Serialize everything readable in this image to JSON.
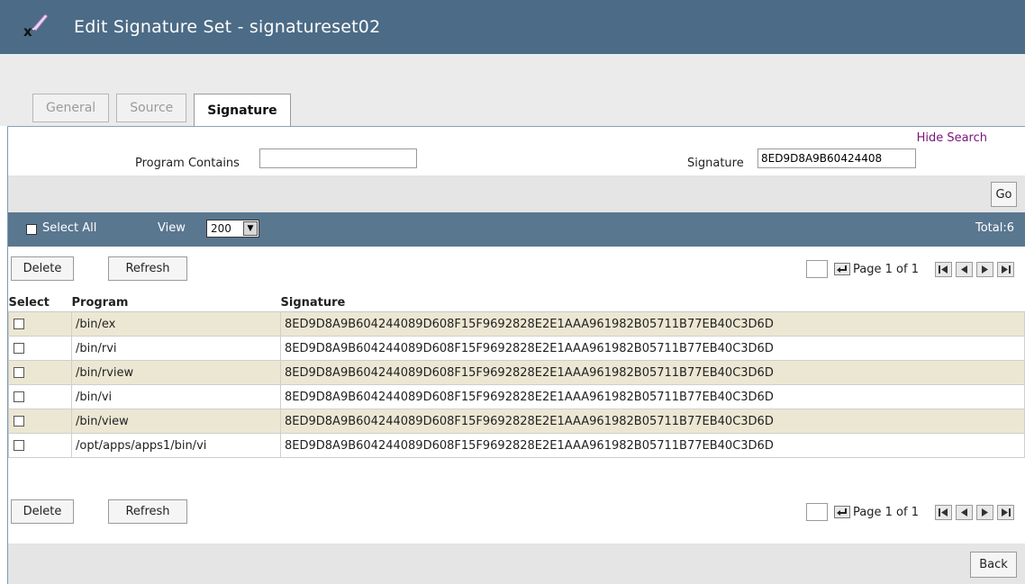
{
  "window": {
    "title": "Edit Signature Set - signatureset02"
  },
  "tabs": [
    {
      "label": "General",
      "active": false
    },
    {
      "label": "Source",
      "active": false
    },
    {
      "label": "Signature",
      "active": true
    }
  ],
  "search": {
    "hide_label": "Hide Search",
    "program_label": "Program Contains",
    "program_value": "",
    "signature_label": "Signature",
    "signature_value": "8ED9D8A9B60424408",
    "go_label": "Go"
  },
  "toolbar": {
    "select_all_label": "Select All",
    "view_label": "View",
    "view_value": "200",
    "total_label": "Total:6"
  },
  "actions": {
    "delete_label": "Delete",
    "refresh_label": "Refresh"
  },
  "pager": {
    "text": "Page 1 of 1"
  },
  "table": {
    "headers": {
      "select": "Select",
      "program": "Program",
      "signature": "Signature"
    },
    "rows": [
      {
        "program": "/bin/ex",
        "signature": "8ED9D8A9B604244089D608F15F9692828E2E1AAA961982B05711B77EB40C3D6D"
      },
      {
        "program": "/bin/rvi",
        "signature": "8ED9D8A9B604244089D608F15F9692828E2E1AAA961982B05711B77EB40C3D6D"
      },
      {
        "program": "/bin/rview",
        "signature": "8ED9D8A9B604244089D608F15F9692828E2E1AAA961982B05711B77EB40C3D6D"
      },
      {
        "program": "/bin/vi",
        "signature": "8ED9D8A9B604244089D608F15F9692828E2E1AAA961982B05711B77EB40C3D6D"
      },
      {
        "program": "/bin/view",
        "signature": "8ED9D8A9B604244089D608F15F9692828E2E1AAA961982B05711B77EB40C3D6D"
      },
      {
        "program": "/opt/apps/apps1/bin/vi",
        "signature": "8ED9D8A9B604244089D608F15F9692828E2E1AAA961982B05711B77EB40C3D6D"
      }
    ]
  },
  "footer": {
    "back_label": "Back"
  },
  "colors": {
    "header_bar": "#4b6b86",
    "list_bar": "#5a7790",
    "row_alt": "#ece7d3",
    "link": "#7a137a"
  },
  "icons": [
    "app-logo-icon",
    "jump-page-icon",
    "first-page-icon",
    "prev-page-icon",
    "next-page-icon",
    "last-page-icon",
    "dropdown-arrow-icon"
  ]
}
